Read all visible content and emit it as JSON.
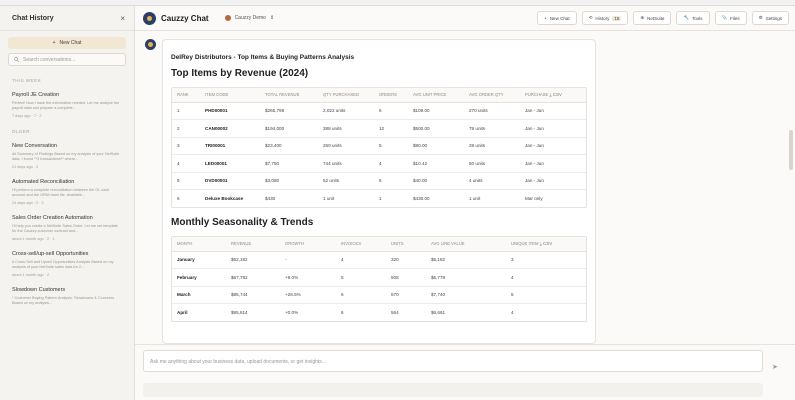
{
  "sidebar": {
    "title": "Chat History",
    "close": "×",
    "new_chat": "New Chat",
    "search_placeholder": "Search conversations...",
    "sections": [
      {
        "label": "THIS WEEK",
        "items": [
          {
            "title": "Payroll JE Creation",
            "preview": "Perfect! Now I have the information needed. Let me analyze the payroll data and prepare a complete...",
            "meta": "7 days ago · 7 · 2"
          }
        ]
      },
      {
        "label": "OLDER",
        "items": [
          {
            "title": "New Conversation",
            "preview": "## Summary of Findings Based on my analysis of your NetSuite data, I found **3 transactions** where...",
            "meta": "21 days ago · 2"
          },
          {
            "title": "Automated Reconciliation",
            "preview": "I'll perform a complete reconciliation between the GL cash account and the GRNI bank file. Available...",
            "meta": "24 days ago · 2 · 2"
          },
          {
            "title": "Sales Order Creation Automation",
            "preview": "I'll help you create a NetSuite Sales Order. Let me set template for the Cauzzy customer contract and...",
            "meta": "about 1 month ago · 2 · 1"
          },
          {
            "title": "Cross-sell/up-sell Opportunities",
            "preview": "# Cross-Sell and Upsell Opportunities Analysis Based on my analysis of your NetSuite sales data for 2...",
            "meta": "about 1 month ago · 2"
          },
          {
            "title": "Slowdown Customers",
            "preview": "* Customer Buying Pattern Analysis: Slowdowns & Concerns Based on my analysis...",
            "meta": ""
          }
        ]
      }
    ]
  },
  "topbar": {
    "app_title": "Cauzzy Chat",
    "workspace": "Cauzzy Demo",
    "buttons": [
      {
        "label": "New Chat",
        "icon": "+"
      },
      {
        "label": "History",
        "icon": "⟲",
        "badge": "15"
      },
      {
        "label": "NetSuite",
        "icon": "⊕"
      },
      {
        "label": "Tools",
        "icon": "🔧"
      },
      {
        "label": "Files",
        "icon": "📎"
      },
      {
        "label": "Settings",
        "icon": "⚙"
      }
    ]
  },
  "document": {
    "title": "DelRey Distributors - Top Items & Buying Patterns Analysis",
    "section1": {
      "heading": "Top Items by Revenue (2024)",
      "columns": [
        "RANK",
        "ITEM CODE",
        "TOTAL REVENUE",
        "QTY PURCHASED",
        "ORDERS",
        "AVG UNIT PRICE",
        "AVG ORDER QTY",
        "PURCHASE"
      ],
      "download": "CSV",
      "rows": [
        [
          "1",
          "PHD00001",
          "$265,798",
          "2,022 units",
          "6",
          "$109.00",
          "270 units",
          "Jan - Jun"
        ],
        [
          "2",
          "CAN00002",
          "$194,000",
          "388 units",
          "12",
          "$500.00",
          "78 units",
          "Jan - Jun"
        ],
        [
          "3",
          "TRI00001",
          "$23,400",
          "260 units",
          "5",
          "$90.00",
          "28 units",
          "Jan - Jun"
        ],
        [
          "4",
          "LED00001",
          "$7,750",
          "744 units",
          "4",
          "$10.42",
          "50 units",
          "Jan - Jun"
        ],
        [
          "5",
          "DVD00001",
          "$3,080",
          "52 units",
          "6",
          "$40.00",
          "4 units",
          "Jan - Jun"
        ],
        [
          "6",
          "Deluxe Bookcase",
          "$430",
          "1 unit",
          "1",
          "$430.00",
          "1 unit",
          "Mar only"
        ]
      ]
    },
    "section2": {
      "heading": "Monthly Seasonality & Trends",
      "columns": [
        "MONTH",
        "REVENUE",
        "GROWTH",
        "INVOICES",
        "UNITS",
        "AVG LINE VALUE",
        "UNIQUE ITEM"
      ],
      "download": "CSV",
      "rows": [
        [
          "January",
          "$62,182",
          "-",
          "4",
          "320",
          "$5,182",
          "3"
        ],
        [
          "February",
          "$67,782",
          "+9.0%",
          "5",
          "508",
          "$6,778",
          "4"
        ],
        [
          "March",
          "$85,744",
          "+26.5%",
          "6",
          "570",
          "$7,740",
          "5"
        ],
        [
          "April",
          "$85,614",
          "+0.0%",
          "6",
          "564",
          "$6,661",
          "4"
        ]
      ]
    }
  },
  "composer": {
    "placeholder": "Ask me anything about your business data, upload documents, or get insights..."
  }
}
